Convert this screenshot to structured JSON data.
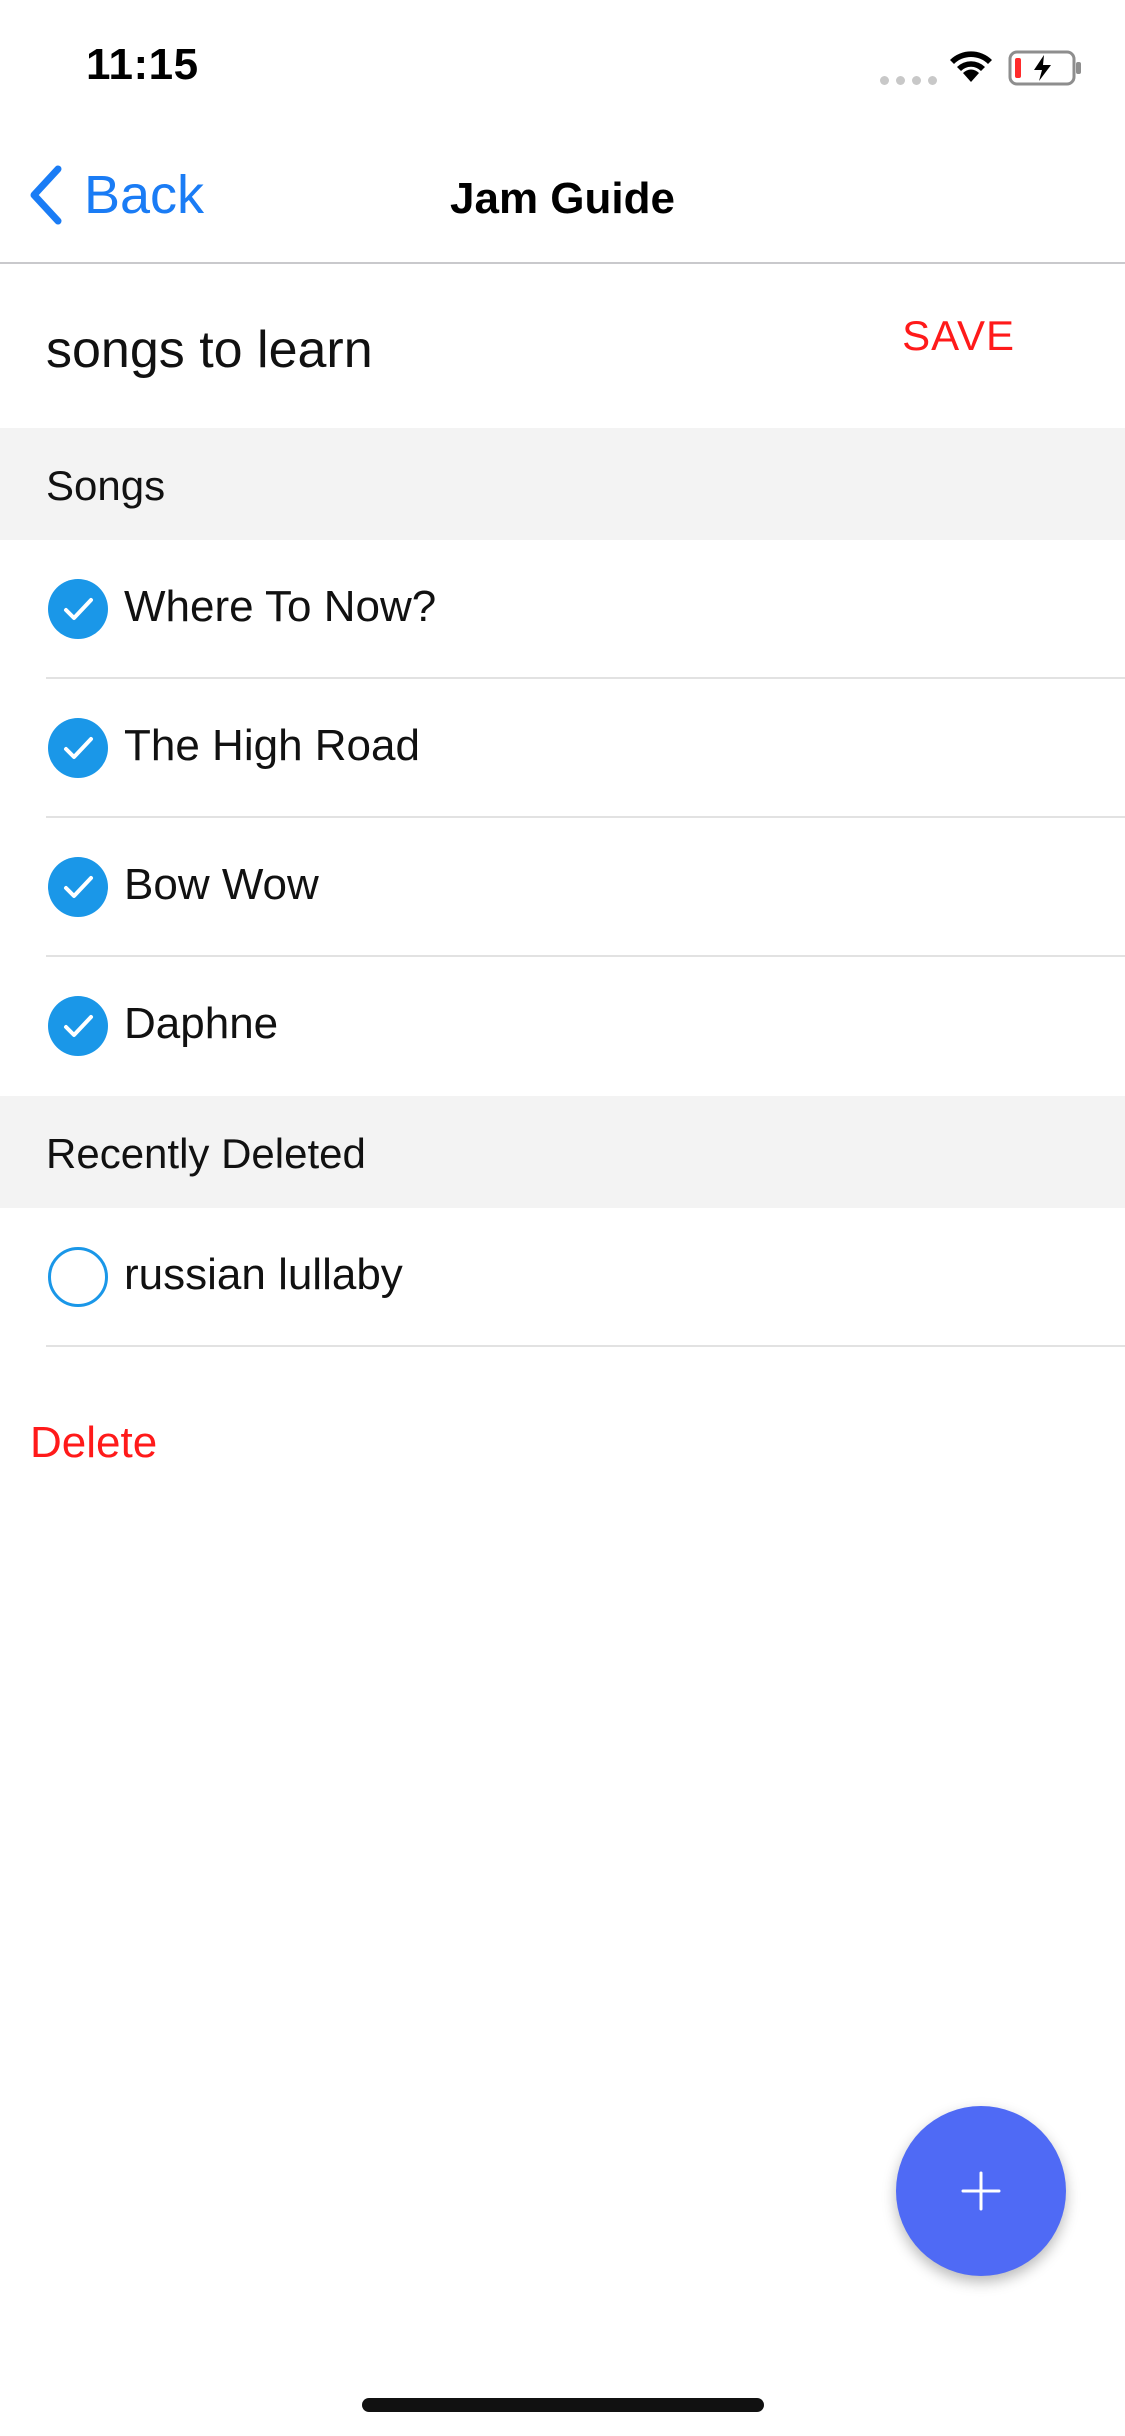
{
  "status_bar": {
    "time": "11:15"
  },
  "nav": {
    "back_label": "Back",
    "title": "Jam Guide"
  },
  "list": {
    "title": "songs to learn",
    "save_label": "SAVE"
  },
  "sections": [
    {
      "header": "Songs",
      "items": [
        {
          "label": "Where To Now?",
          "checked": true
        },
        {
          "label": "The High Road",
          "checked": true
        },
        {
          "label": "Bow Wow",
          "checked": true
        },
        {
          "label": "Daphne",
          "checked": true
        }
      ]
    },
    {
      "header": "Recently Deleted",
      "items": [
        {
          "label": "russian lullaby",
          "checked": false
        }
      ]
    }
  ],
  "delete_label": "Delete",
  "fab": {
    "icon": "plus-icon"
  },
  "colors": {
    "accent_blue": "#1a7cf5",
    "check_blue": "#1a97e8",
    "danger_red": "#ff1a1a",
    "fab_blue": "#4f6af5",
    "section_bg": "#f3f3f3"
  }
}
